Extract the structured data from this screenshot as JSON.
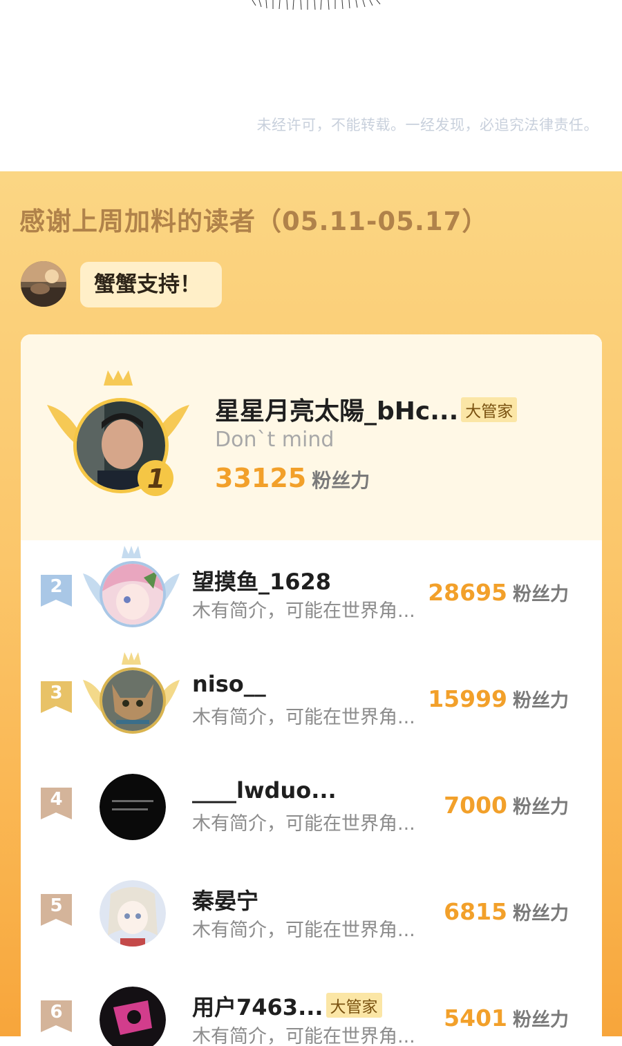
{
  "notice": "未经许可，不能转载。一经发现，必追究法律责任。",
  "section_title": "感谢上周加料的读者（05.11-05.17）",
  "message": {
    "text": "蟹蟹支持！"
  },
  "top_reader": {
    "rank": "1",
    "name": "星星月亮太陽_bHc...",
    "role": "大管家",
    "desc": "Don`t mind",
    "score": "33125",
    "unit": "粉丝力"
  },
  "readers": [
    {
      "rank": "2",
      "name": "望摸鱼_1628",
      "role": "",
      "desc": "木有简介，可能在世界角...",
      "score": "28695",
      "unit": "粉丝力"
    },
    {
      "rank": "3",
      "name": "niso__",
      "role": "",
      "desc": "木有简介，可能在世界角...",
      "score": "15999",
      "unit": "粉丝力"
    },
    {
      "rank": "4",
      "name": "____lwduo...",
      "role": "",
      "desc": "木有简介，可能在世界角...",
      "score": "7000",
      "unit": "粉丝力"
    },
    {
      "rank": "5",
      "name": "秦晏宁",
      "role": "",
      "desc": "木有简介，可能在世界角...",
      "score": "6815",
      "unit": "粉丝力"
    },
    {
      "rank": "6",
      "name": "用户7463...",
      "role": "大管家",
      "desc": "木有简介，可能在世界角...",
      "score": "5401",
      "unit": "粉丝力"
    }
  ],
  "colors": {
    "panel": "#fbc66a",
    "score": "#f2a02a",
    "gold": "#f5c645",
    "silver": "#a9c7e6",
    "bronze": "#e8c267",
    "rank_plain": "#d4b49a"
  }
}
